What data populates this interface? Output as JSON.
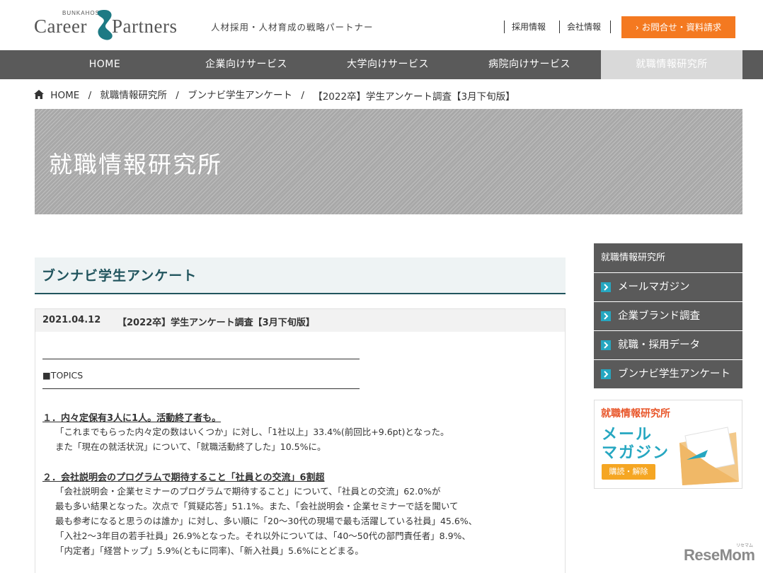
{
  "header": {
    "logo_small": "BUNKAHOSO",
    "logo_career": "Career",
    "logo_partners": "Partners",
    "tagline": "人材採用・人材育成の戦略パートナー",
    "links": [
      "採用情報",
      "会社情報"
    ],
    "contact_button": "お問合せ・資料請求",
    "accent_color": "#f47920",
    "logo_mark_color": "#1e7a84"
  },
  "nav": {
    "items": [
      "HOME",
      "企業向けサービス",
      "大学向けサービス",
      "病院向けサービス",
      "就職情報研究所"
    ],
    "active_index": 4
  },
  "breadcrumb": {
    "items": [
      "HOME",
      "就職情報研究所",
      "ブンナビ学生アンケート",
      "【2022卒】学生アンケート調査【3月下旬版】"
    ],
    "separator": "/"
  },
  "hero": {
    "title": "就職情報研究所"
  },
  "section": {
    "title": "ブンナビ学生アンケート"
  },
  "article": {
    "date": "2021.04.12",
    "title": "【2022卒】学生アンケート調査【3月下旬版】",
    "topics_label": "■TOPICS",
    "points": [
      {
        "title": "１．内々定保有3人に1人。活動終了者も。",
        "lines": [
          "「これまでもらった内々定の数はいくつか」に対し、「1社以上」33.4%(前回比+9.6pt)となった。",
          "また「現在の就活状況」について、「就職活動終了した」10.5%に。"
        ]
      },
      {
        "title": "２．会社説明会のプログラムで期待すること「社員との交流」6割超",
        "lines": [
          "「会社説明会・企業セミナーのプログラムで期待すること」について、「社員との交流」62.0%が",
          "最も多い結果となった。次点で「質疑応答」51.1%。また、「会社説明会・企業セミナーで話を聞いて",
          "最も参考になると思うのは誰か」に対し、多い順に「20～30代の現場で最も活躍している社員」45.6%、",
          "「入社2～3年目の若手社員」26.9%となった。それ以外については、「40～50代の部門責任者」8.9%、",
          "「内定者」「経営トップ」5.9%(ともに同率)、「新入社員」5.6%にとどまる。"
        ]
      }
    ]
  },
  "sidebar": {
    "title": "就職情報研究所",
    "items": [
      "メールマガジン",
      "企業ブランド調査",
      "就職・採用データ",
      "ブンナビ学生アンケート"
    ],
    "arrow_color": "#26a7c1"
  },
  "banner": {
    "top": "就職情報研究所",
    "line1": "メール",
    "line2": "マガジン",
    "button": "購読・解除"
  },
  "watermark": {
    "text": "ReseMom",
    "small": "リセマム"
  }
}
